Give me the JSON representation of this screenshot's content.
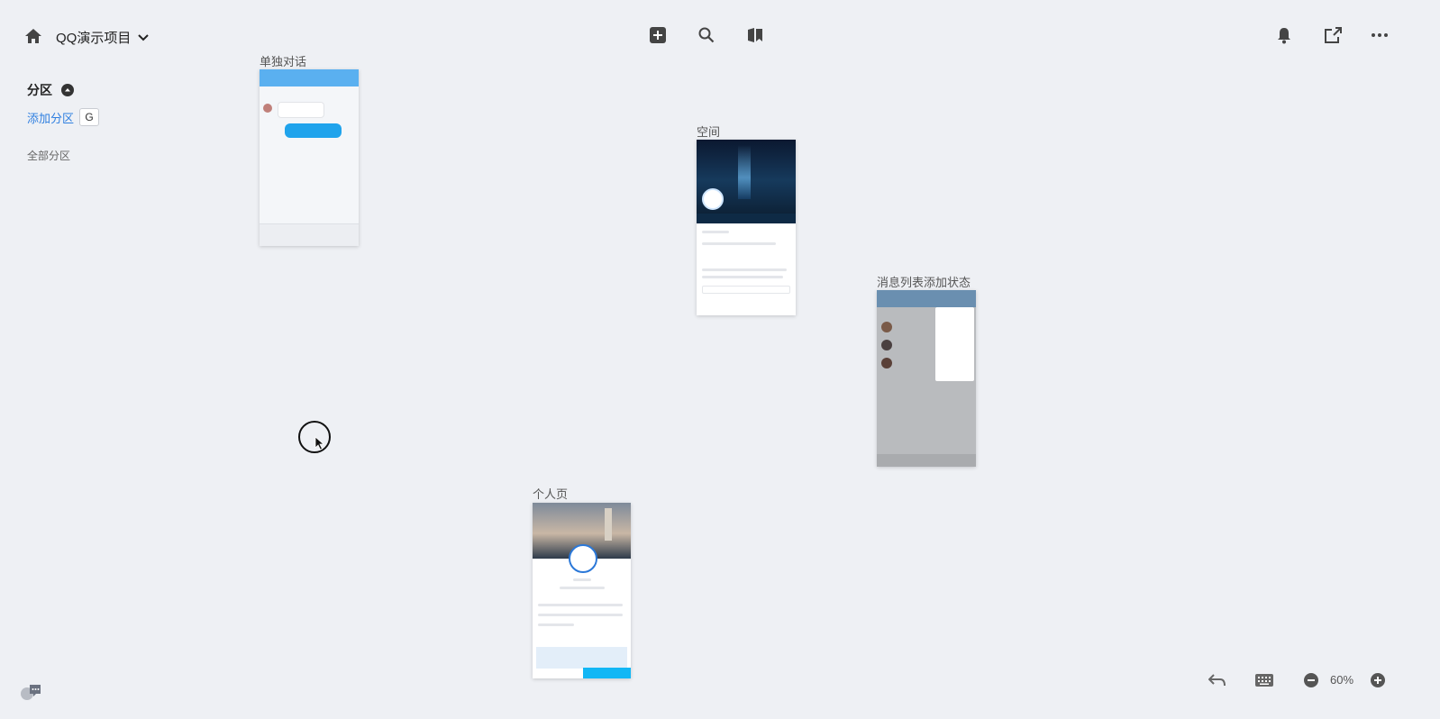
{
  "header": {
    "project_title": "QQ演示项目",
    "icons": [
      "home-icon",
      "chevron-down-icon",
      "add-icon",
      "search-icon",
      "bookmark-icon",
      "bell-icon",
      "share-icon",
      "more-icon"
    ]
  },
  "sidebar": {
    "section_title": "分区",
    "add_section_label": "添加分区",
    "add_section_shortcut": "G",
    "all_sections_label": "全部分区"
  },
  "artboards": [
    {
      "label": "单独对话"
    },
    {
      "label": "空间"
    },
    {
      "label": "消息列表添加状态"
    },
    {
      "label": "个人页"
    }
  ],
  "footer": {
    "zoom_level": "60%"
  },
  "colors": {
    "accent": "#2f7fe0",
    "background": "#eef0f4",
    "qq_blue": "#12b7f5"
  }
}
